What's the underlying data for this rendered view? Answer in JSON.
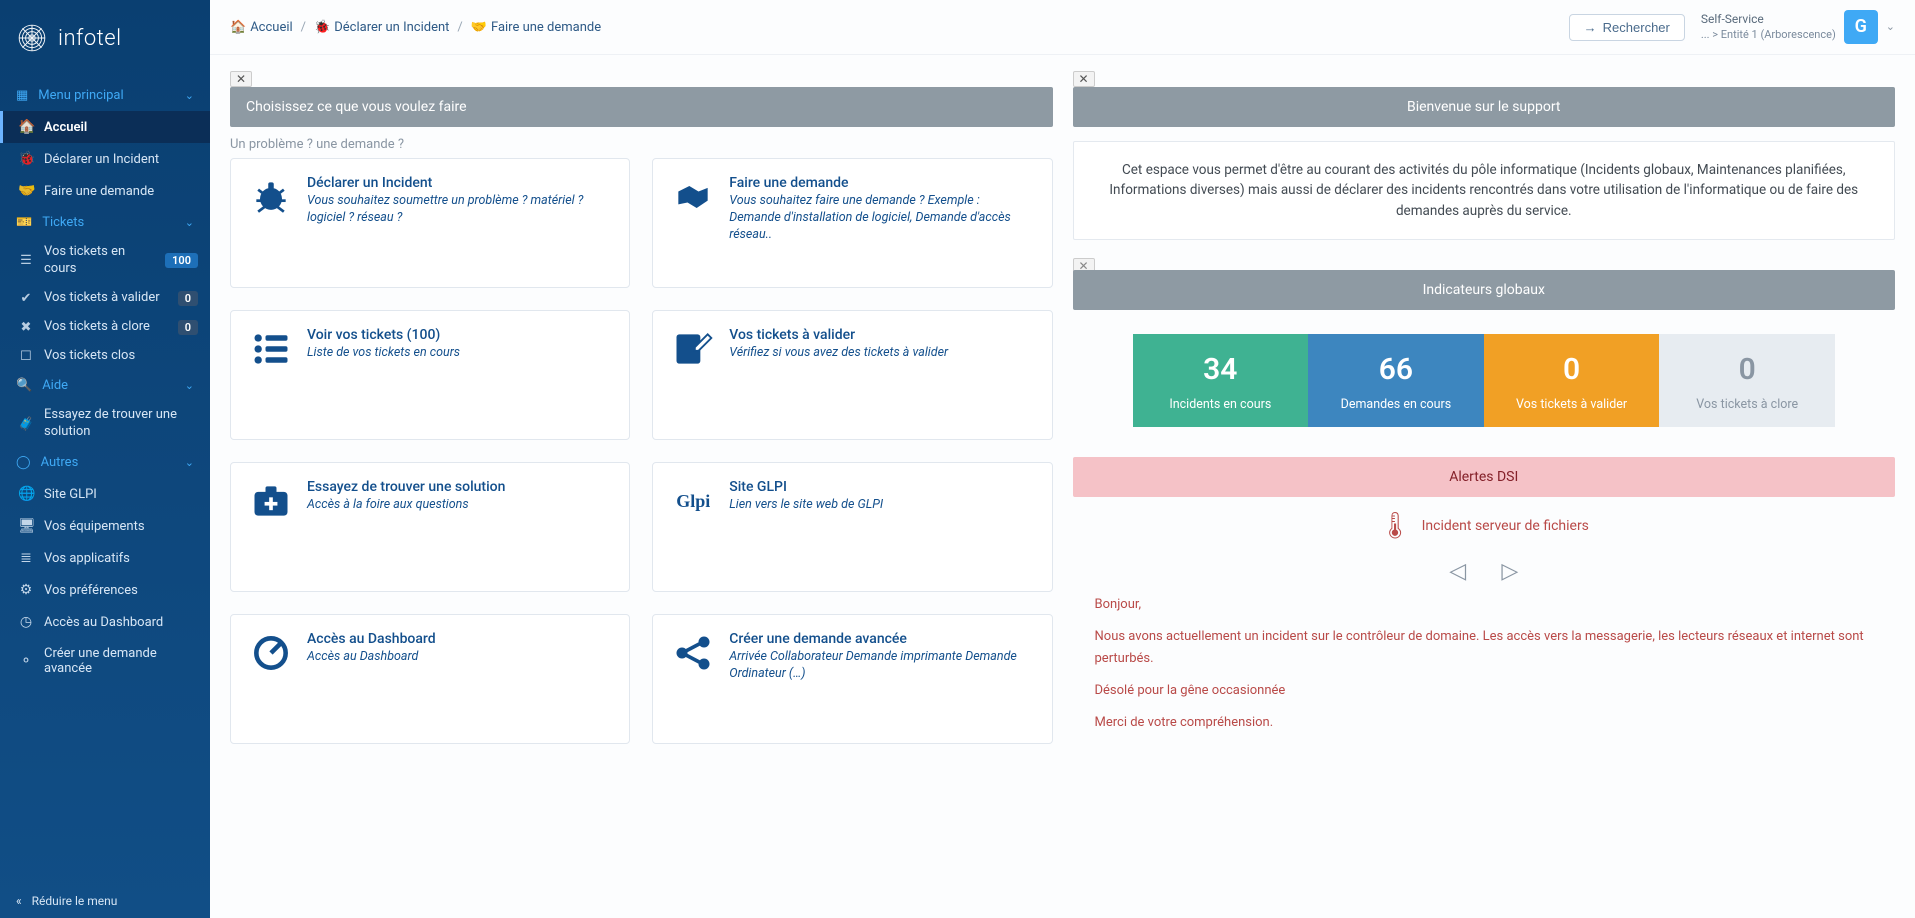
{
  "brand": "infotel",
  "breadcrumbs": {
    "home": "Accueil",
    "declare": "Déclarer un Incident",
    "request": "Faire une demande"
  },
  "topbar": {
    "search": "Rechercher",
    "profile_line1": "Self-Service",
    "profile_line2": "... > Entité 1 (Arborescence)",
    "avatar_letter": "G"
  },
  "sidebar": {
    "main_label": "Menu principal",
    "items_main": [
      {
        "icon": "home",
        "label": "Accueil"
      },
      {
        "icon": "bug",
        "label": "Déclarer un Incident"
      },
      {
        "icon": "hand",
        "label": "Faire une demande"
      }
    ],
    "tickets_label": "Tickets",
    "items_tickets": [
      {
        "icon": "list",
        "label": "Vos tickets en cours",
        "badge": "100"
      },
      {
        "icon": "stamp",
        "label": "Vos tickets à valider",
        "badge": "0"
      },
      {
        "icon": "close-list",
        "label": "Vos tickets à clore",
        "badge": "0"
      },
      {
        "icon": "archive",
        "label": "Vos tickets clos",
        "badge": ""
      }
    ],
    "help_label": "Aide",
    "items_help": [
      {
        "icon": "case",
        "label": "Essayez de trouver une solution"
      }
    ],
    "other_label": "Autres",
    "items_other": [
      {
        "icon": "globe",
        "label": "Site GLPI"
      },
      {
        "icon": "monitor",
        "label": "Vos équipements"
      },
      {
        "icon": "layers",
        "label": "Vos applicatifs"
      },
      {
        "icon": "gear",
        "label": "Vos préférences"
      },
      {
        "icon": "dash",
        "label": "Accès au Dashboard"
      },
      {
        "icon": "share",
        "label": "Créer une demande avancée"
      }
    ],
    "collapse": "Réduire le menu"
  },
  "left": {
    "head": "Choisissez ce que vous voulez faire",
    "subt": "Un problème ? une demande ?",
    "cards": [
      {
        "title": "Déclarer un Incident",
        "desc": "Vous souhaitez soumettre un problème ? matériel ? logiciel ? réseau ?"
      },
      {
        "title": "Faire une demande",
        "desc": "Vous souhaitez faire une demande ? Exemple : Demande d'installation de logiciel, Demande d'accès réseau.."
      },
      {
        "title": "Voir vos tickets (100)",
        "desc": "Liste de vos tickets en cours"
      },
      {
        "title": "Vos tickets à valider",
        "desc": "Vérifiez si vous avez des tickets à valider"
      },
      {
        "title": "Essayez de trouver une solution",
        "desc": "Accès à la foire aux questions"
      },
      {
        "title": "Site GLPI",
        "desc": "Lien vers le site web de GLPI"
      },
      {
        "title": "Accès au Dashboard",
        "desc": "Accès au Dashboard"
      },
      {
        "title": "Créer une demande avancée",
        "desc": "Arrivée Collaborateur Demande imprimante Demande Ordinateur (…)"
      }
    ]
  },
  "right": {
    "welcome_head": "Bienvenue sur le support",
    "welcome_body": "Cet espace vous permet d'être au courant des activités du pôle informatique (Incidents globaux, Maintenances planifiées, Informations diverses) mais aussi de déclarer des incidents rencontrés dans votre utilisation de l'informatique ou de faire des demandes auprès du service.",
    "indicators_head": "Indicateurs globaux",
    "kpis": [
      {
        "num": "34",
        "lab": "Incidents en cours",
        "cls": "green"
      },
      {
        "num": "66",
        "lab": "Demandes en cours",
        "cls": "blue"
      },
      {
        "num": "0",
        "lab": "Vos tickets à valider",
        "cls": "orange"
      },
      {
        "num": "0",
        "lab": "Vos tickets à clore",
        "cls": "gray"
      }
    ],
    "alerts_head": "Alertes DSI",
    "alert_title": "Incident serveur de fichiers",
    "alert_body": {
      "p1": "Bonjour,",
      "p2": "Nous avons actuellement un incident sur le contrôleur de domaine. Les accès vers la messagerie, les lecteurs réseaux et internet sont perturbés.",
      "p3": "Désolé pour la gêne occasionnée",
      "p4": "Merci de votre compréhension."
    }
  }
}
